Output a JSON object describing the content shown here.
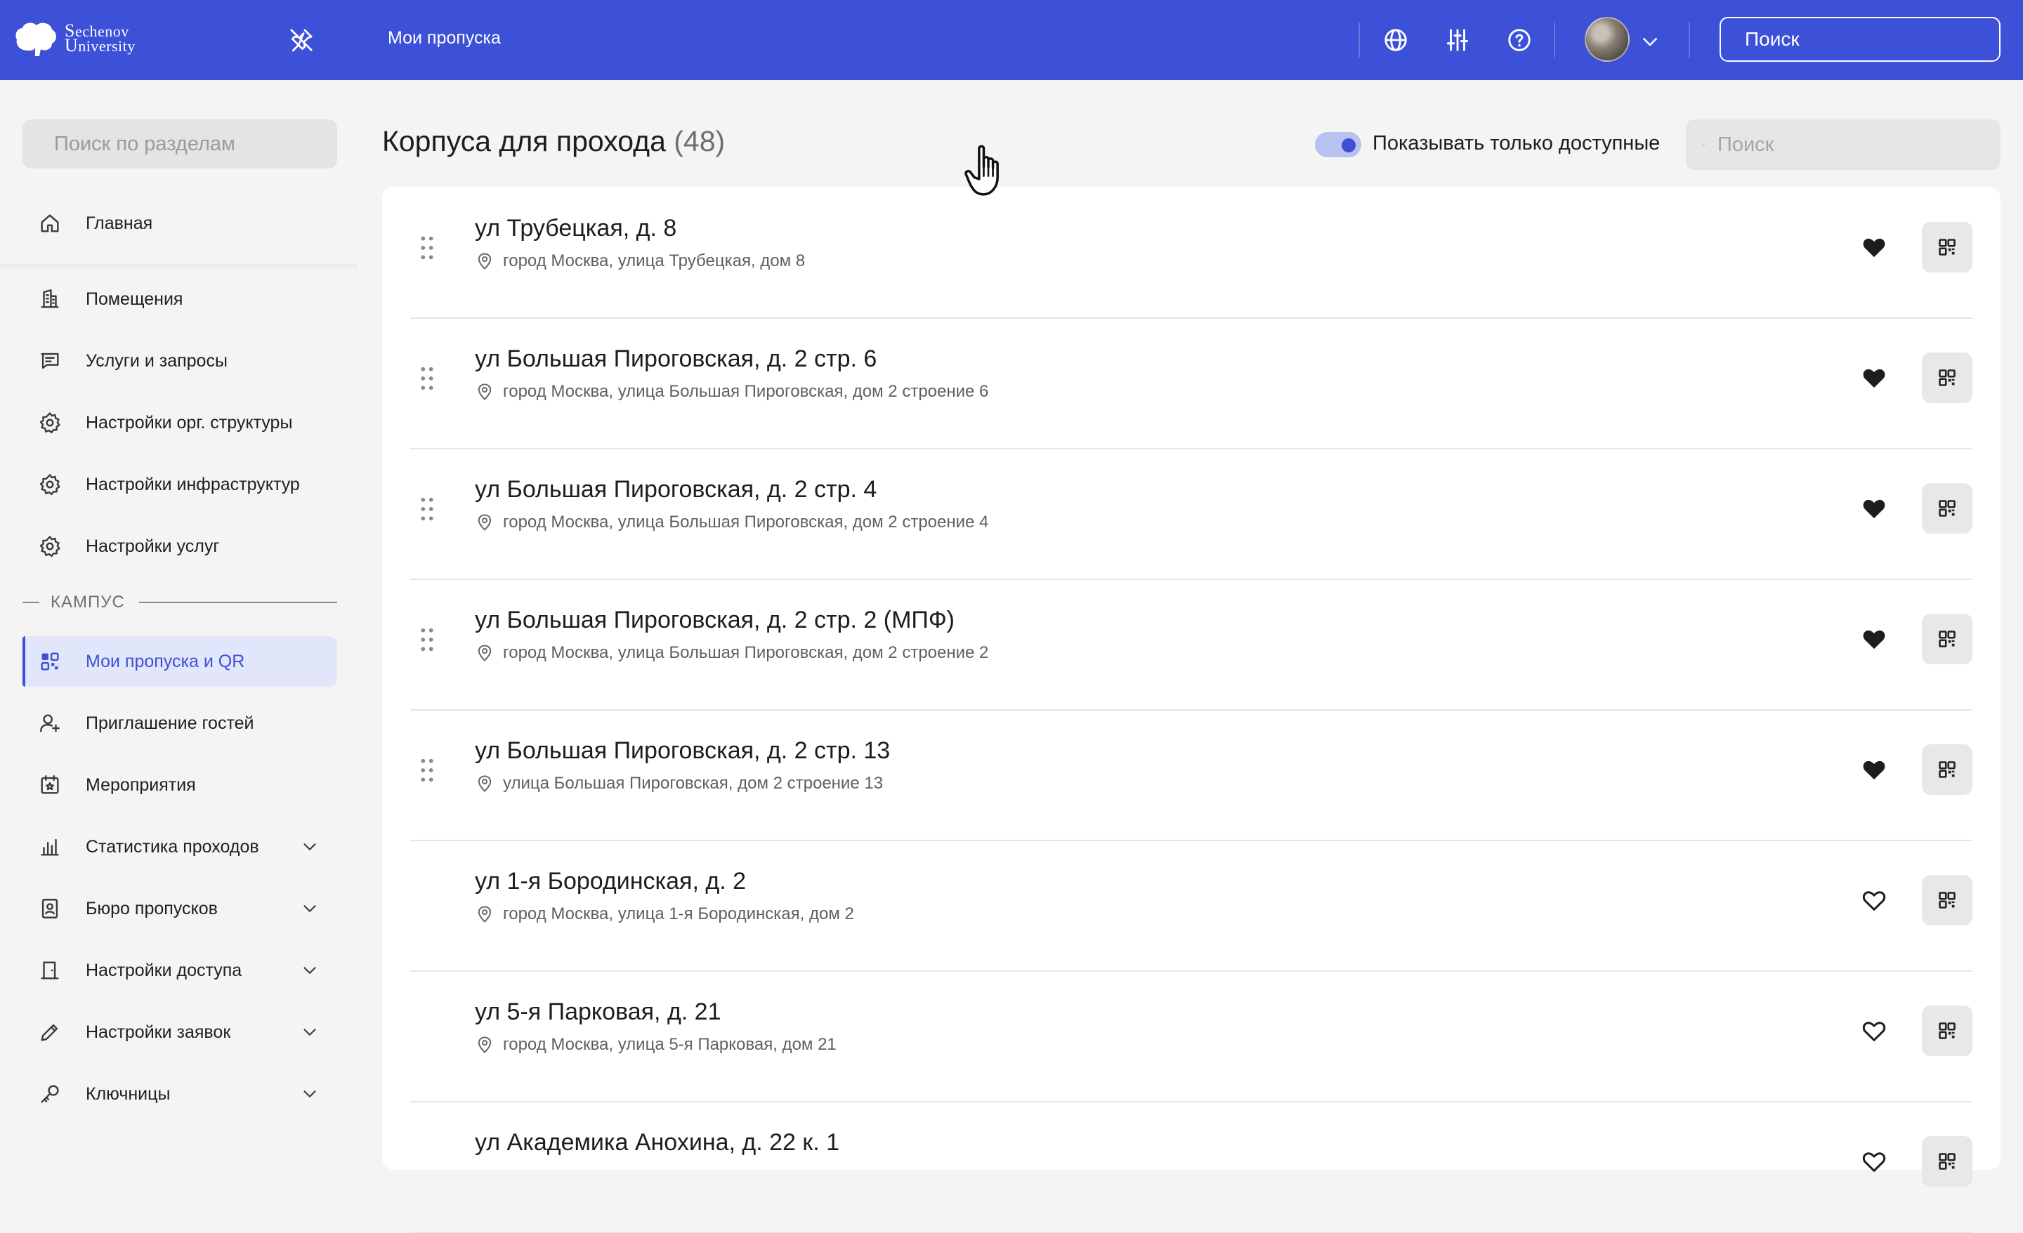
{
  "colors": {
    "brand": "#3c50d8",
    "active_bg": "#e2e6fb",
    "panel": "#ffffff",
    "page_bg": "#f4f4f4"
  },
  "header": {
    "logo_line1": "Sechenov",
    "logo_line2": "University",
    "breadcrumb": "Мои пропуска",
    "icons": [
      "globe-icon",
      "sliders-icon",
      "help-icon"
    ],
    "search_placeholder": "Поиск"
  },
  "sidebar": {
    "search_placeholder": "Поиск по разделам",
    "items_top": [
      {
        "label": "Главная",
        "icon": "home-icon"
      }
    ],
    "items_admin": [
      {
        "label": "Помещения",
        "icon": "building-icon"
      },
      {
        "label": "Услуги и запросы",
        "icon": "message-icon"
      },
      {
        "label": "Настройки орг. структуры",
        "icon": "gear-icon"
      },
      {
        "label": "Настройки инфраструктур",
        "icon": "gear-icon"
      },
      {
        "label": "Настройки услуг",
        "icon": "gear-icon"
      }
    ],
    "section_label": "КАМПУС",
    "items_campus": [
      {
        "label": "Мои пропуска и QR",
        "icon": "qr-icon",
        "active": true
      },
      {
        "label": "Приглашение гостей",
        "icon": "user-add-icon"
      },
      {
        "label": "Мероприятия",
        "icon": "calendar-star-icon"
      },
      {
        "label": "Статистика проходов",
        "icon": "bar-chart-icon",
        "expandable": true
      },
      {
        "label": "Бюро пропусков",
        "icon": "badge-icon",
        "expandable": true
      },
      {
        "label": "Настройки доступа",
        "icon": "door-icon",
        "expandable": true
      },
      {
        "label": "Настройки заявок",
        "icon": "pencil-icon",
        "expandable": true
      },
      {
        "label": "Ключницы",
        "icon": "key-icon",
        "expandable": true
      }
    ]
  },
  "main": {
    "title": "Корпуса для прохода",
    "count": "(48)",
    "toggle_label": "Показывать только доступные",
    "toggle_on": true,
    "search_placeholder": "Поиск",
    "buildings": [
      {
        "title": "ул Трубецкая, д. 8",
        "address": "город Москва, улица Трубецкая, дом 8",
        "favorite": true,
        "draggable": true
      },
      {
        "title": "ул Большая Пироговская, д. 2 стр. 6",
        "address": "город Москва, улица Большая Пироговская, дом 2 строение 6",
        "favorite": true,
        "draggable": true
      },
      {
        "title": "ул Большая Пироговская, д. 2 стр. 4",
        "address": "город Москва, улица Большая Пироговская, дом 2 строение 4",
        "favorite": true,
        "draggable": true
      },
      {
        "title": "ул Большая Пироговская, д. 2 стр. 2 (МПФ)",
        "address": "город Москва, улица Большая Пироговская, дом 2 строение 2",
        "favorite": true,
        "draggable": true
      },
      {
        "title": "ул Большая Пироговская, д. 2 стр. 13",
        "address": "улица Большая Пироговская, дом 2 строение 13",
        "favorite": true,
        "draggable": true
      },
      {
        "title": "ул 1-я Бородинская, д. 2",
        "address": "город Москва, улица 1-я Бородинская, дом 2",
        "favorite": false,
        "draggable": false
      },
      {
        "title": "ул 5-я Парковая, д. 21",
        "address": "город Москва, улица 5-я Парковая, дом 21",
        "favorite": false,
        "draggable": false
      },
      {
        "title": "ул Академика Анохина, д. 22 к. 1",
        "address": "",
        "favorite": false,
        "draggable": false
      }
    ]
  }
}
